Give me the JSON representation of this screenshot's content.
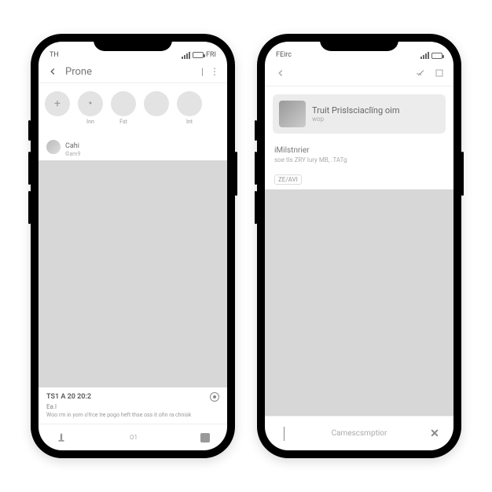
{
  "phone1": {
    "status": {
      "left": "TH",
      "right": "FRI"
    },
    "header": {
      "title": "Prone",
      "menu_glyph": "⋮"
    },
    "stories": [
      {
        "glyph": "+",
        "label": ""
      },
      {
        "glyph": "•",
        "label": "Inn"
      },
      {
        "glyph": "",
        "label": "Fst"
      },
      {
        "glyph": "",
        "label": ""
      },
      {
        "glyph": "",
        "label": "Int"
      }
    ],
    "post": {
      "user": "Cahi",
      "subline": "©am9",
      "date": "TS1 A 20 20:2",
      "caption_label": "Ea.l",
      "caption": "Woo rm in yorn o'frce tre pogo heft thse oss it ofin ra chnisk"
    },
    "nav": {
      "label": "O1"
    }
  },
  "phone2": {
    "status": {
      "left": "FEirc"
    },
    "card": {
      "title": "Truit Prislsciaclïng oim",
      "sub": "wop"
    },
    "body": {
      "title": "iMilstnrier",
      "sub": "soe tls ZRY lury MB, .TATg",
      "tag": "ZE/AVI"
    },
    "footer": {
      "placeholder": "Camescsmptior"
    }
  }
}
